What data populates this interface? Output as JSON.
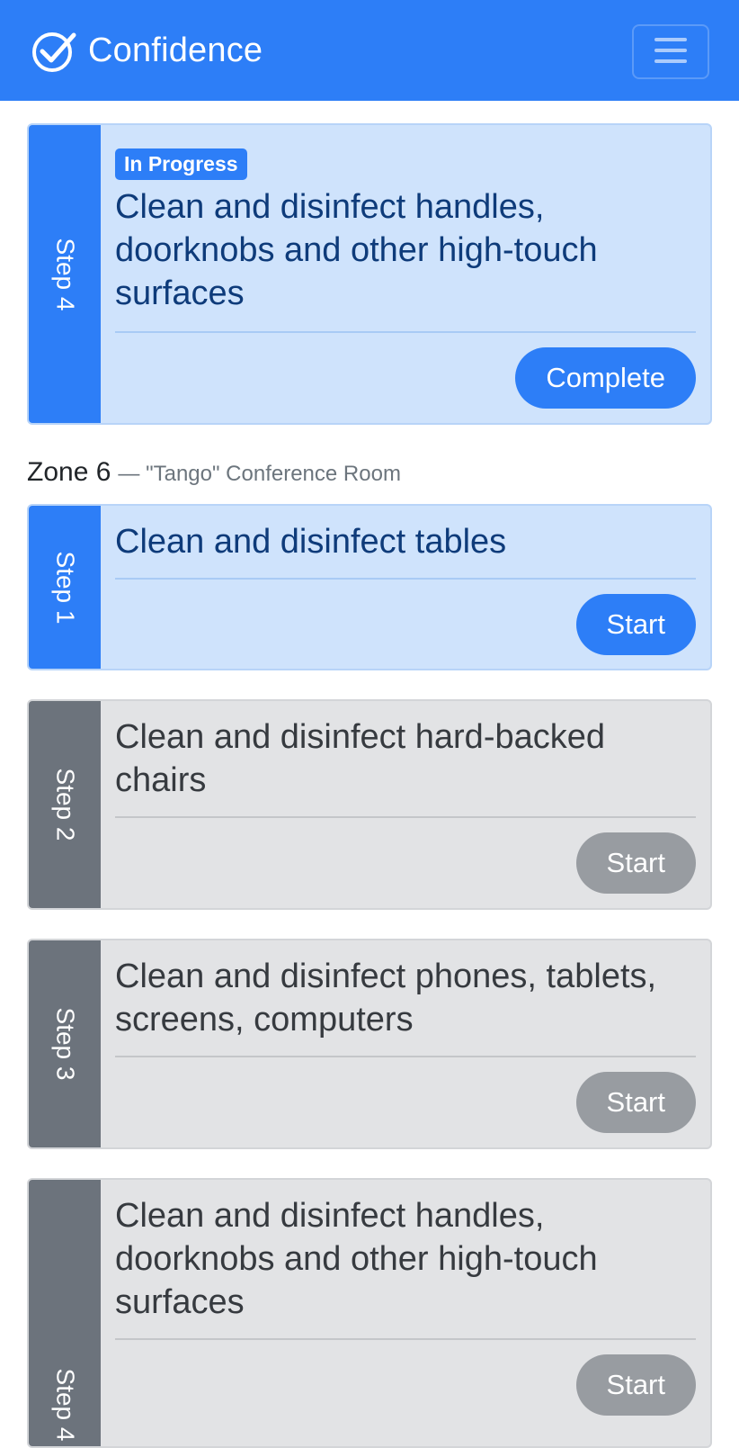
{
  "app": {
    "title": "Confidence",
    "brand_color": "#2d7ef7"
  },
  "current_step": {
    "step_label": "Step 4",
    "status_badge": "In Progress",
    "title": "Clean and disinfect handles, doorknobs and other high-touch surfaces",
    "action_label": "Complete"
  },
  "zone": {
    "name": "Zone 6",
    "subtitle": "— \"Tango\" Conference Room",
    "steps": [
      {
        "step_label": "Step 1",
        "title": "Clean and disinfect tables",
        "action_label": "Start",
        "state": "next"
      },
      {
        "step_label": "Step 2",
        "title": "Clean and disinfect hard-backed chairs",
        "action_label": "Start",
        "state": "pending"
      },
      {
        "step_label": "Step 3",
        "title": "Clean and disinfect phones, tablets, screens, computers",
        "action_label": "Start",
        "state": "pending"
      },
      {
        "step_label": "Step 4",
        "title": "Clean and disinfect handles, doorknobs and other high-touch surfaces",
        "action_label": "Start",
        "state": "pending"
      }
    ]
  },
  "icons": {
    "brand": "check-circle-icon",
    "menu": "hamburger-menu-icon"
  }
}
